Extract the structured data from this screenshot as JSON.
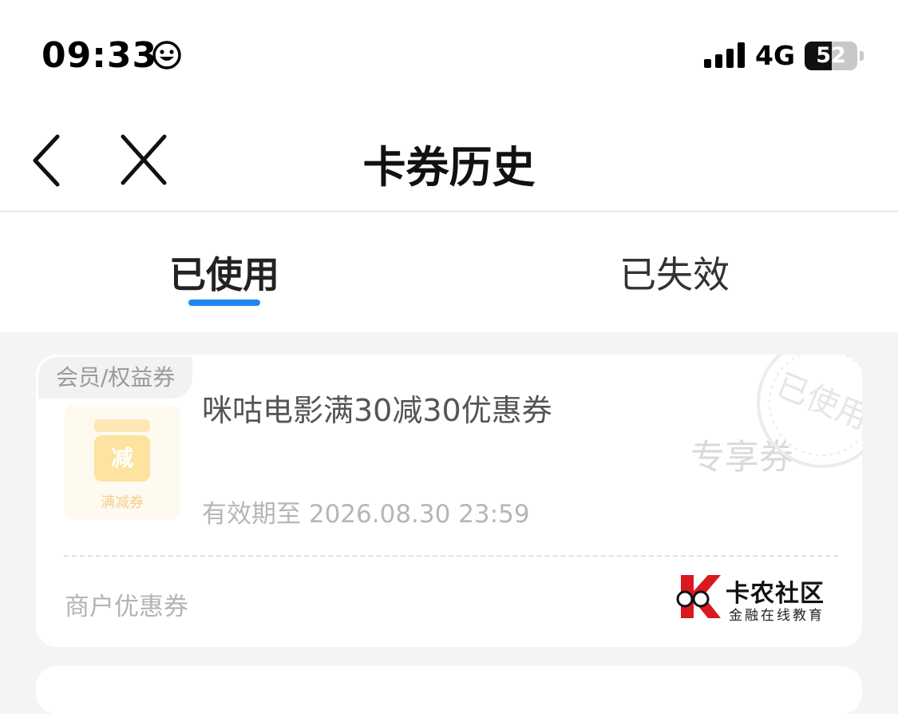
{
  "status_bar": {
    "time": "09:33",
    "network": "4G",
    "battery": "52",
    "battery_fraction": 0.52
  },
  "nav": {
    "title": "卡券历史"
  },
  "tabs": [
    {
      "label": "已使用",
      "active": true
    },
    {
      "label": "已失效",
      "active": false
    }
  ],
  "colors": {
    "accent": "#1e88f0"
  },
  "icons": {
    "back": "chevron-left-icon",
    "close": "close-icon",
    "status_emoji": "smiley-icon",
    "signal": "signal-bars-icon",
    "battery": "battery-icon"
  },
  "coupons": [
    {
      "category": "会员/权益券",
      "thumbnail_char": "减",
      "thumbnail_label": "满减券",
      "title": "咪咕电影满30减30优惠券",
      "expiry": "有效期至 2026.08.30 23:59",
      "badge": "专享券",
      "stamp": "已使用",
      "merchant": "商户优惠券"
    }
  ],
  "watermark": {
    "name": "卡农社区",
    "tagline": "金融在线教育"
  }
}
